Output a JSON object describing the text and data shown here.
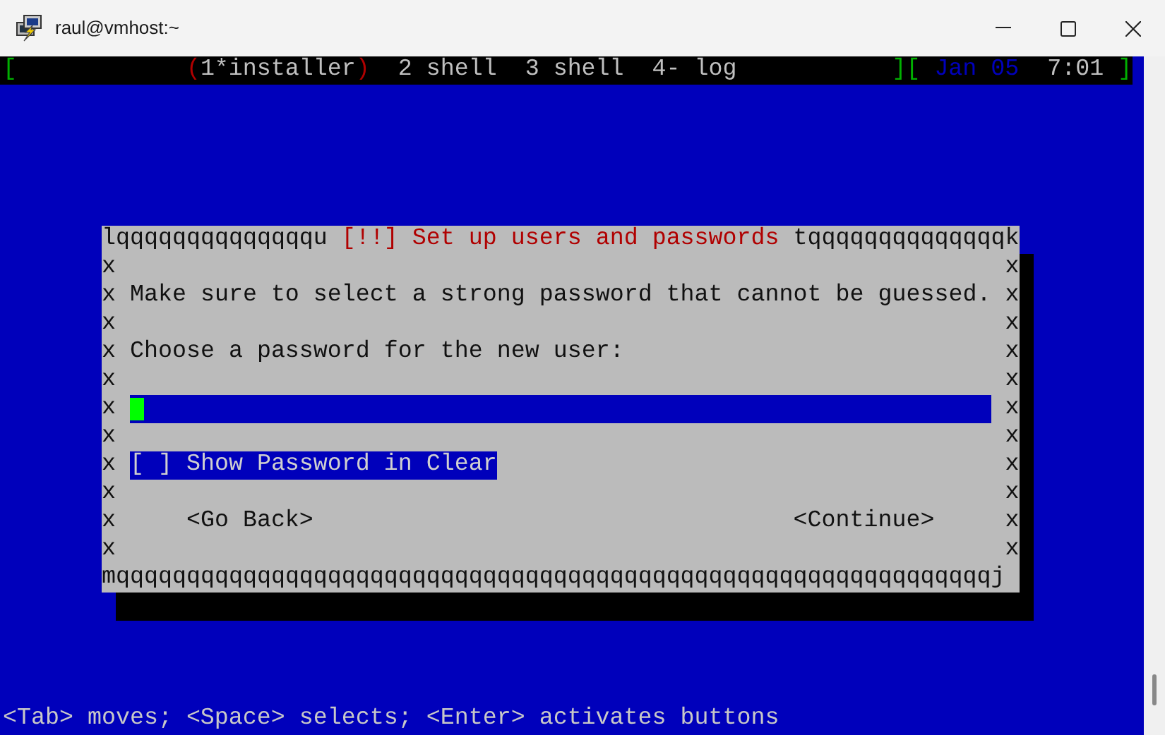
{
  "window": {
    "title": "raul@vmhost:~"
  },
  "status_bar": {
    "open": "[",
    "selected_markers": [
      "(",
      ")"
    ],
    "windows": [
      {
        "label": "1*installer",
        "selected": true
      },
      {
        "label": "2 shell",
        "selected": false
      },
      {
        "label": "3 shell",
        "selected": false
      },
      {
        "label": "4- log",
        "selected": false
      }
    ],
    "divider": "][",
    "date": "Jan 05",
    "time": "7:01",
    "close": "]"
  },
  "dialog": {
    "frame_left": "lqqqqqqqqqqqqqqu",
    "title": "[!!] Set up users and passwords",
    "frame_right": "tqqqqqqqqqqqqqqk",
    "rows": [
      {
        "kind": "blank",
        "sides": [
          "x",
          "x"
        ]
      },
      {
        "kind": "text",
        "sides": [
          "x",
          "x"
        ],
        "text": "Make sure to select a strong password that cannot be guessed."
      },
      {
        "kind": "blank",
        "sides": [
          "x",
          "x"
        ]
      },
      {
        "kind": "text",
        "sides": [
          "x",
          "x"
        ],
        "text": "Choose a password for the new user:"
      },
      {
        "kind": "blank",
        "sides": [
          "x",
          "x"
        ]
      },
      {
        "kind": "field",
        "sides": [
          "x",
          "x"
        ],
        "cursor": true
      },
      {
        "kind": "blank",
        "sides": [
          "x",
          "x"
        ]
      },
      {
        "kind": "checkbox",
        "sides": [
          "x",
          "x"
        ],
        "box": "[ ]",
        "label": "Show Password in Clear",
        "focused": true
      },
      {
        "kind": "blank",
        "sides": [
          "x",
          "x"
        ]
      },
      {
        "kind": "buttons",
        "sides": [
          "x",
          "x"
        ],
        "buttons": [
          {
            "label": "<Go Back>",
            "selected": false
          },
          {
            "label": "<Continue>",
            "selected": false
          }
        ]
      },
      {
        "kind": "blank",
        "sides": [
          "x",
          "x"
        ]
      }
    ],
    "frame_bottom": "mqqqqqqqqqqqqqqqqqqqqqqqqqqqqqqqqqqqqqqqqqqqqqqqqqqqqqqqqqqqqqqj"
  },
  "help_line": "<Tab> moves; <Space> selects; <Enter> activates buttons"
}
